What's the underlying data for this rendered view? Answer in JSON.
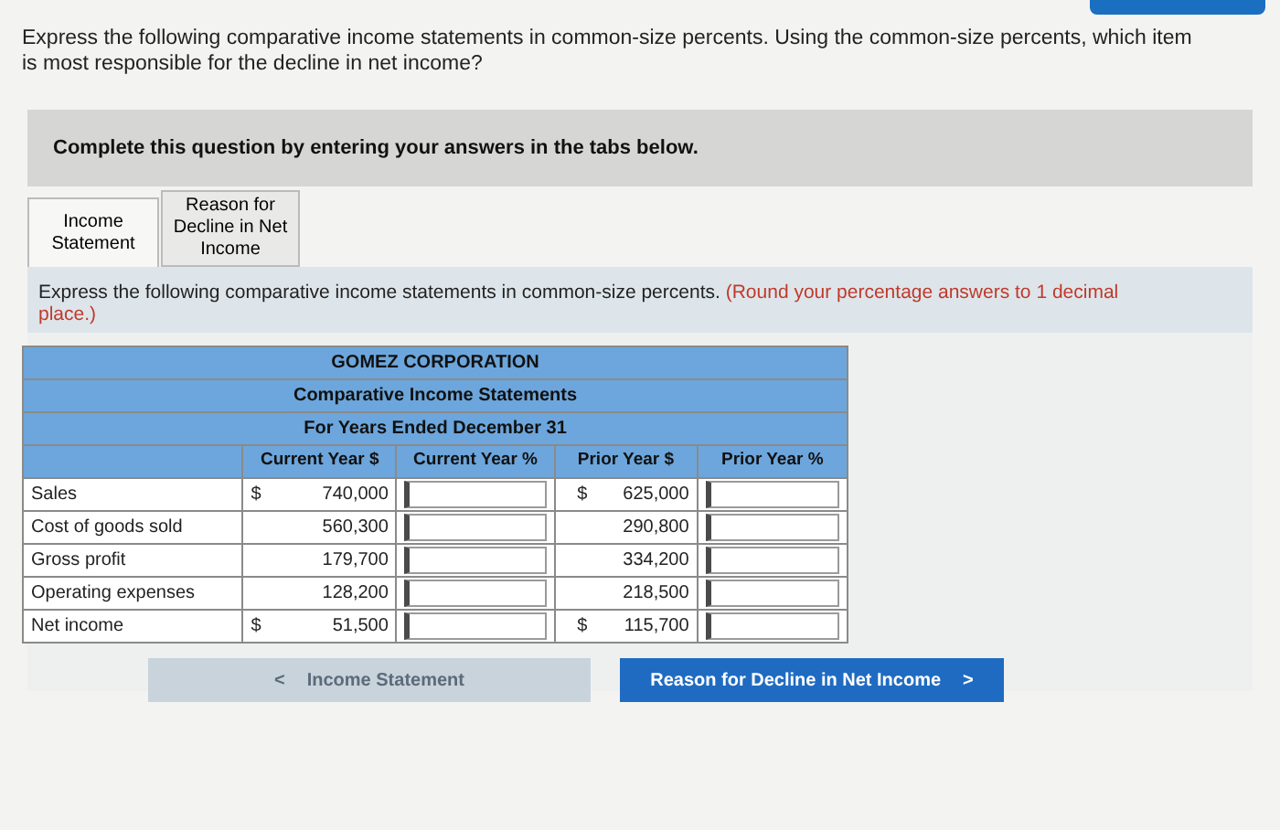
{
  "question": "Express the following comparative income statements in common-size percents. Using the common-size percents, which item is most responsible for the decline in net income?",
  "banner": "Complete this question by entering your answers in the tabs below.",
  "tabs": [
    {
      "label": "Income Statement",
      "selected": true
    },
    {
      "label": "Reason for Decline in Net Income",
      "selected": false
    }
  ],
  "instruction": {
    "text": "Express the following comparative income statements in common-size percents.",
    "note": "(Round your percentage answers to 1 decimal place.)"
  },
  "table": {
    "title": "GOMEZ CORPORATION",
    "subtitle": "Comparative Income Statements",
    "period": "For Years Ended December 31",
    "columns": [
      "Current Year $",
      "Current Year %",
      "Prior Year $",
      "Prior Year %"
    ],
    "rows": [
      {
        "label": "Sales",
        "currency_current": "$",
        "current": "740,000",
        "currency_prior": "$",
        "prior": "625,000"
      },
      {
        "label": "Cost of goods sold",
        "current": "560,300",
        "prior": "290,800"
      },
      {
        "label": "Gross profit",
        "current": "179,700",
        "prior": "334,200"
      },
      {
        "label": "Operating expenses",
        "current": "128,200",
        "prior": "218,500"
      },
      {
        "label": "Net income",
        "currency_current": "$",
        "current": "51,500",
        "currency_prior": "$",
        "prior": "115,700"
      }
    ]
  },
  "nav": [
    {
      "label": "Income Statement",
      "arrow": "<",
      "disabled": true
    },
    {
      "label": "Reason for Decline in Net Income",
      "arrow": ">",
      "disabled": false
    }
  ]
}
